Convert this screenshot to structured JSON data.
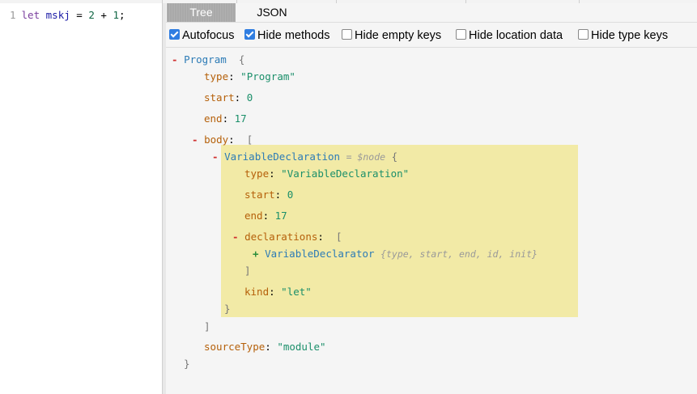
{
  "editor": {
    "line_number": "1",
    "tokens": {
      "kw": "let",
      "ident": "mskj",
      "eq": "=",
      "n1": "2",
      "op": "+",
      "n2": "1",
      "semi": ";"
    }
  },
  "tabs": {
    "tree": "Tree",
    "json": "JSON",
    "active": "Tree"
  },
  "options": [
    {
      "label": "Autofocus",
      "checked": true
    },
    {
      "label": "Hide methods",
      "checked": true
    },
    {
      "label": "Hide empty keys",
      "checked": false
    },
    {
      "label": "Hide location data",
      "checked": false
    },
    {
      "label": "Hide type keys",
      "checked": false
    }
  ],
  "tree": {
    "collapse_toggle": "-",
    "expand_toggle": "+",
    "program": {
      "name": "Program",
      "open_brace": "{",
      "close_brace": "}",
      "type_key": "type",
      "type_value": "\"Program\"",
      "start_key": "start",
      "start_value": "0",
      "end_key": "end",
      "end_value": "17",
      "body_key": "body",
      "open_bracket": "[",
      "close_bracket": "]",
      "source_type_key": "sourceType",
      "source_type_value": "\"module\""
    },
    "var_decl": {
      "name": "VariableDeclaration",
      "node_ref": "= $node",
      "open_brace": "{",
      "close_brace": "}",
      "type_key": "type",
      "type_value": "\"VariableDeclaration\"",
      "start_key": "start",
      "start_value": "0",
      "end_key": "end",
      "end_value": "17",
      "declarations_key": "declarations",
      "open_bracket": "[",
      "close_bracket": "]",
      "kind_key": "kind",
      "kind_value": "\"let\""
    },
    "declarator": {
      "name": "VariableDeclarator",
      "summary": "{type, start, end, id, init}"
    }
  },
  "colors": {
    "highlight": "#f2eaa6",
    "node_name": "#2c7bb6",
    "key": "#b5600a",
    "string": "#1b8f6a",
    "toggle": "#d0302f",
    "checkbox_on": "#2f7de1",
    "active_tab": "#a9a9a9"
  }
}
